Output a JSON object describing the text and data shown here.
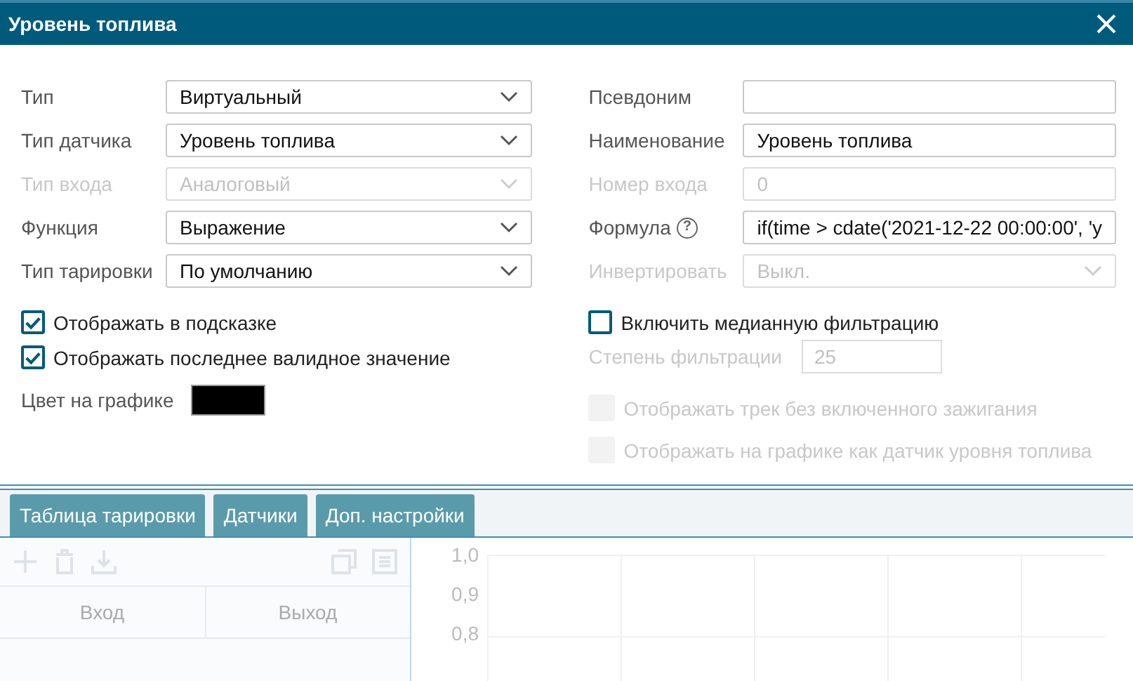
{
  "window": {
    "title": "Уровень топлива"
  },
  "left_fields": [
    {
      "label": "Тип",
      "value": "Виртуальный",
      "disabled": false,
      "kind": "select"
    },
    {
      "label": "Тип датчика",
      "value": "Уровень топлива",
      "disabled": false,
      "kind": "select"
    },
    {
      "label": "Тип входа",
      "value": "Аналоговый",
      "disabled": true,
      "kind": "select"
    },
    {
      "label": "Функция",
      "value": "Выражение",
      "disabled": false,
      "kind": "select"
    },
    {
      "label": "Тип тарировки",
      "value": "По умолчанию",
      "disabled": false,
      "kind": "select"
    }
  ],
  "right_fields": [
    {
      "label": "Псевдоним",
      "disabled": false,
      "kind": "input"
    },
    {
      "label": "Наименование",
      "value": "Уровень топлива",
      "disabled": false,
      "kind": "input"
    },
    {
      "label": "Номер входа",
      "value": "0",
      "disabled": true,
      "kind": "input"
    },
    {
      "label": "Формула",
      "help": "?",
      "value": "if(time > cdate('2021-12-22 00:00:00', 'y",
      "disabled": false,
      "kind": "input"
    },
    {
      "label": "Инвертировать",
      "value": "Выкл.",
      "disabled": true,
      "kind": "select"
    }
  ],
  "left_checks": [
    {
      "label": "Отображать в подсказке",
      "checked": true,
      "disabled": false
    },
    {
      "label": "Отображать последнее валидное значение",
      "checked": true,
      "disabled": false
    }
  ],
  "graph_color": {
    "label": "Цвет на графике",
    "color": "#000000"
  },
  "right_checks": [
    {
      "label": "Включить медианную фильтрацию",
      "checked": false,
      "disabled": false
    }
  ],
  "filter_degree": {
    "label": "Степень фильтрации",
    "value": "25",
    "disabled": true
  },
  "right_extra_checks": [
    {
      "label": "Отображать трек без включенного зажигания",
      "checked": false,
      "disabled": true
    },
    {
      "label": "Отображать на графике как датчик уровня топлива",
      "checked": false,
      "disabled": true
    }
  ],
  "tabs": [
    {
      "label": "Таблица тарировки",
      "selected": false
    },
    {
      "label": "Датчики",
      "selected": false
    },
    {
      "label": "Доп. настройки",
      "selected": false
    }
  ],
  "table": {
    "columns": [
      "Вход",
      "Выход"
    ]
  },
  "chart": {
    "y_ticks": [
      "1,0",
      "0,9",
      "0,8"
    ]
  }
}
